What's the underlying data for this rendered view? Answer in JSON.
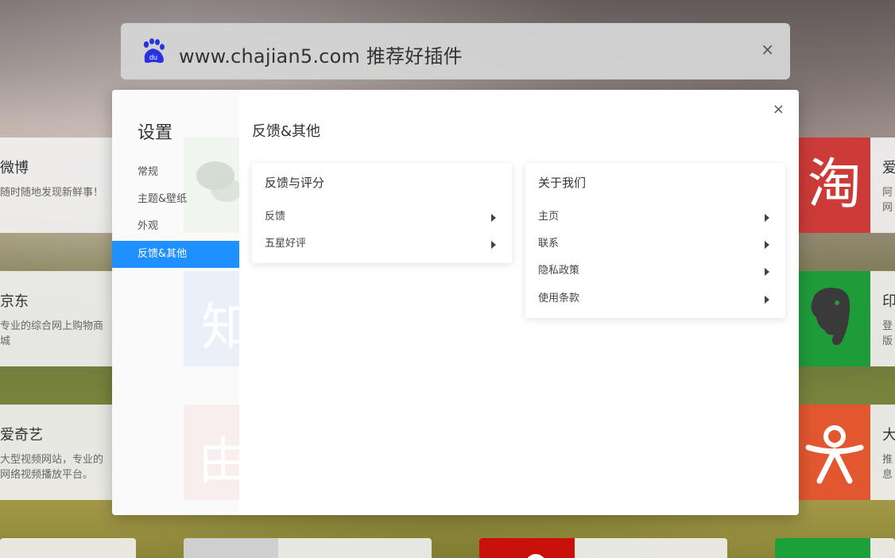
{
  "search": {
    "text": "www.chajian5.com 推荐好插件",
    "close": "×",
    "logo_icon": "baidu-paw-icon"
  },
  "tiles": {
    "weibo": {
      "name": "微博",
      "desc": "随时随地发现新鲜事！"
    },
    "jd": {
      "name": "京东",
      "desc": "专业的综合网上购物商城"
    },
    "iqiyi": {
      "name": "爱奇艺",
      "desc": "大型视频网站，专业的网络视频播放平台。"
    },
    "taobao": {
      "name": "爱",
      "desc": "阿网",
      "glyph": "淘"
    },
    "evernote": {
      "name": "印",
      "desc": "登版"
    },
    "dahua": {
      "name": "大",
      "desc": "推息"
    }
  },
  "settings": {
    "title": "设置",
    "close": "×",
    "nav": [
      "常规",
      "主题&壁纸",
      "外观",
      "反馈&其他"
    ],
    "active_index": 3,
    "section_title": "反馈&其他",
    "feedback_card": {
      "title": "反馈与评分",
      "items": [
        "反馈",
        "五星好评"
      ]
    },
    "about_card": {
      "title": "关于我们",
      "items": [
        "主页",
        "联系",
        "隐私政策",
        "使用条款"
      ]
    }
  },
  "colors": {
    "accent": "#1e90ff",
    "taobao": "#cc3b38",
    "evernote": "#1f9c3a",
    "dahua": "#e2572f",
    "red_tile": "#c9100a",
    "green_tile": "#1aa13a"
  }
}
